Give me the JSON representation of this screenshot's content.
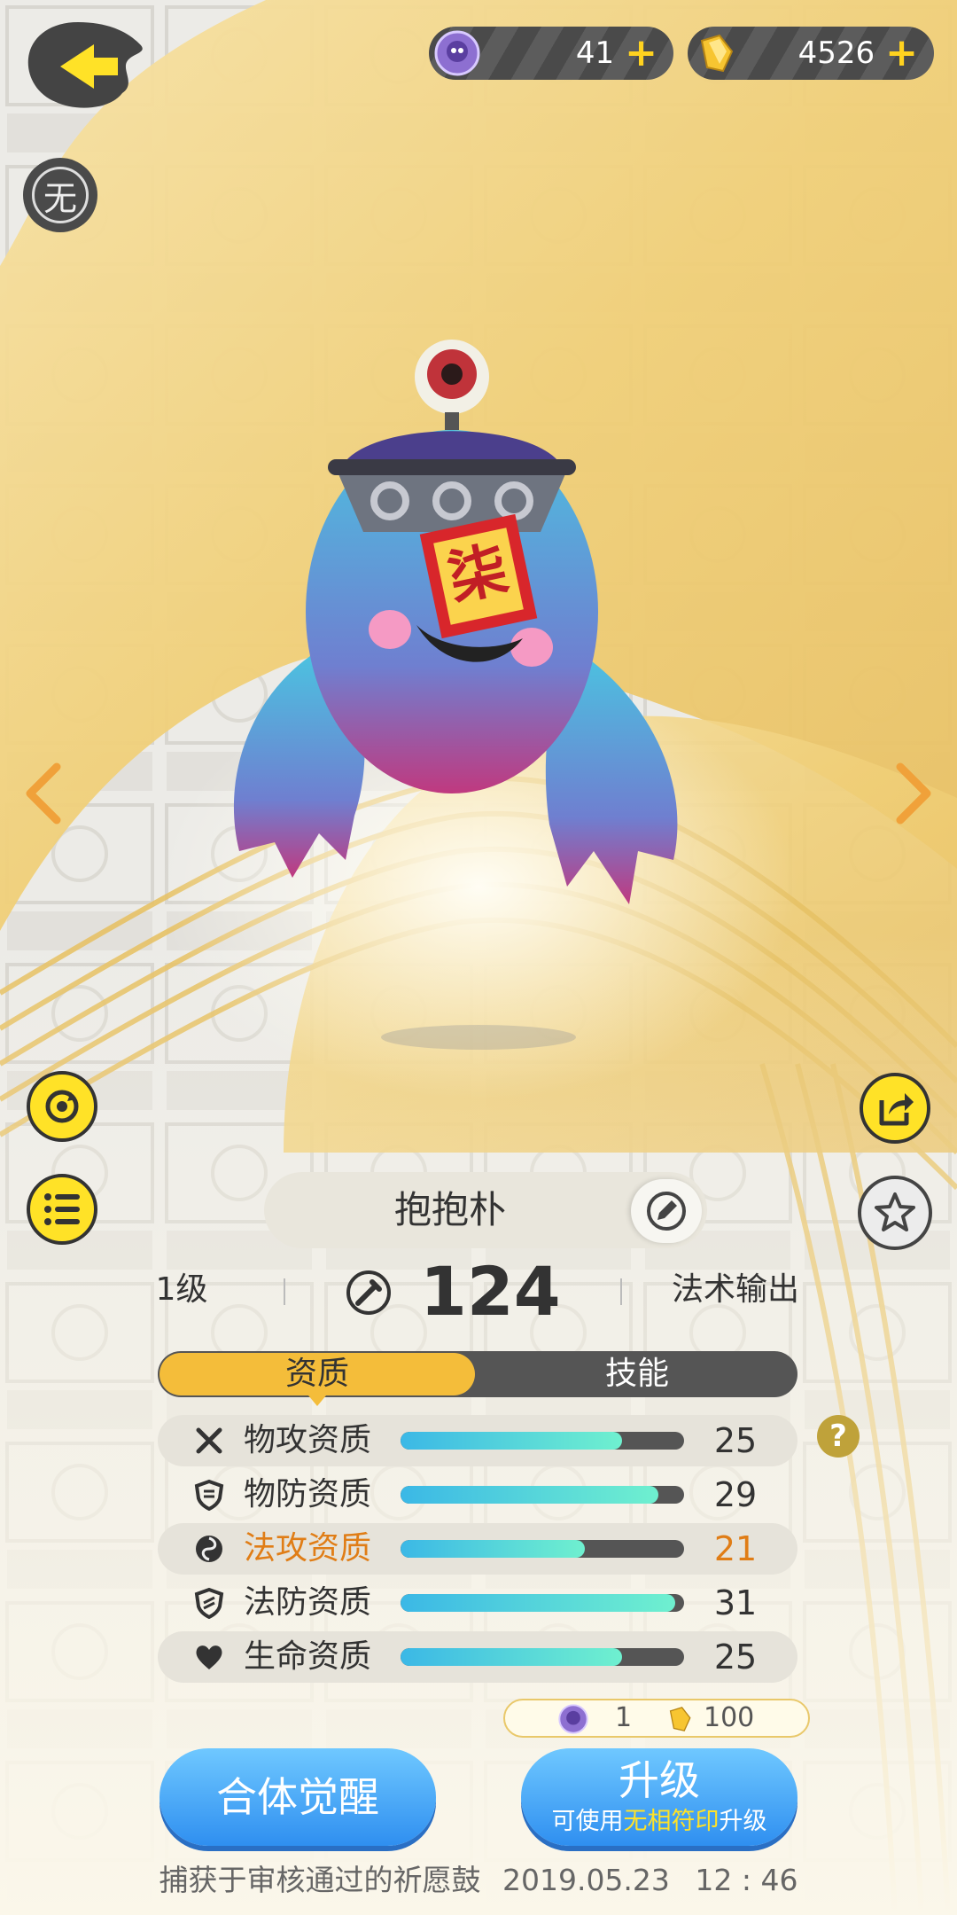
{
  "currency": {
    "soul": {
      "icon": "ghost-coin-icon",
      "value": "41"
    },
    "gold": {
      "icon": "gold-ingot-icon",
      "value": "4526"
    }
  },
  "left_badge": "无",
  "pet": {
    "name": "抱抱朴",
    "talisman_char": "柒",
    "level": "1级",
    "power": "124",
    "role": "法术输出"
  },
  "tabs": {
    "active": "资质",
    "inactive": "技能"
  },
  "stats": [
    {
      "label": "物攻资质",
      "value": "25",
      "fill": 0.78,
      "icon": "crossed-swords-icon",
      "highlight": false,
      "shaded": true
    },
    {
      "label": "物防资质",
      "value": "29",
      "fill": 0.91,
      "icon": "shield-icon",
      "highlight": false,
      "shaded": false
    },
    {
      "label": "法攻资质",
      "value": "21",
      "fill": 0.65,
      "icon": "magic-swirl-icon",
      "highlight": true,
      "shaded": true
    },
    {
      "label": "法防资质",
      "value": "31",
      "fill": 0.97,
      "icon": "magic-shield-icon",
      "highlight": false,
      "shaded": false
    },
    {
      "label": "生命资质",
      "value": "25",
      "fill": 0.78,
      "icon": "heart-icon",
      "highlight": false,
      "shaded": true
    }
  ],
  "help_glyph": "?",
  "cost": {
    "soul": "1",
    "gold": "100"
  },
  "buttons": {
    "awaken": "合体觉醒",
    "upgrade": "升级",
    "upgrade_sub_pre": "可使用",
    "upgrade_sub_item": "无相符印",
    "upgrade_sub_post": "升级"
  },
  "footer": {
    "capture_text": "捕获于审核通过的祈愿鼓",
    "date": "2019.05.23",
    "time": "12 : 46"
  },
  "colors": {
    "accent_yellow": "#ffe227",
    "highlight_orange": "#e07d16",
    "button_blue": "#3f9cf4",
    "tab_active": "#f4bd3a"
  }
}
